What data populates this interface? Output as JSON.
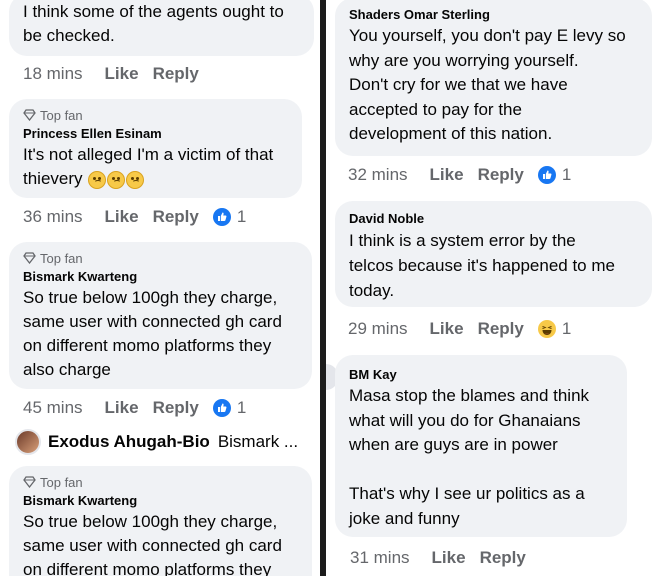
{
  "left": {
    "c1": {
      "body": "I think some of the agents ought to\nbe checked.",
      "time": "18 mins",
      "like": "Like",
      "reply": "Reply"
    },
    "c2": {
      "badge": "Top fan",
      "author": "Princess Ellen Esinam",
      "body": "It's not alleged I'm a victim of that\nthievery",
      "time": "36 mins",
      "like": "Like",
      "reply": "Reply",
      "count": "1"
    },
    "c3": {
      "badge": "Top fan",
      "author": "Bismark Kwarteng",
      "body": "So true below 100gh they charge,\nsame user with connected gh card\non different momo platforms they\nalso charge",
      "time": "45 mins",
      "like": "Like",
      "reply": "Reply",
      "count": "1"
    },
    "reply_row": {
      "name": "Exodus Ahugah-Bio",
      "preview": "Bismark ..."
    },
    "c4": {
      "badge": "Top fan",
      "author": "Bismark Kwarteng",
      "body": "So true below 100gh they charge,\nsame user with connected gh card\non different momo platforms they"
    }
  },
  "right": {
    "c1": {
      "author": "Shaders Omar Sterling",
      "body": "You yourself, you don't pay E levy so\nwhy are you worrying yourself.\nDon't cry for we that we have\naccepted to pay for the\ndevelopment of this nation.",
      "time": "32 mins",
      "like": "Like",
      "reply": "Reply",
      "count": "1"
    },
    "c2": {
      "author": "David Noble",
      "body": "I think is a system error by the\ntelcos because it's happened to me\ntoday.",
      "time": "29 mins",
      "like": "Like",
      "reply": "Reply",
      "count": "1"
    },
    "c3": {
      "author": "BM Kay",
      "body": "Masa stop the blames and think\nwhat will you do for Ghanaians\nwhen are guys are in power\n\nThat's why I see ur politics as a\njoke and funny",
      "time": "31 mins",
      "like": "Like",
      "reply": "Reply"
    }
  },
  "colors": {
    "bubble": "#f0f2f5",
    "meta": "#65676b",
    "like_blue": "#1877f2",
    "haha_yellow": "#f7c948"
  },
  "icons": [
    "diamond-icon",
    "like-reaction-icon",
    "haha-reaction-icon",
    "worried-emoji"
  ]
}
